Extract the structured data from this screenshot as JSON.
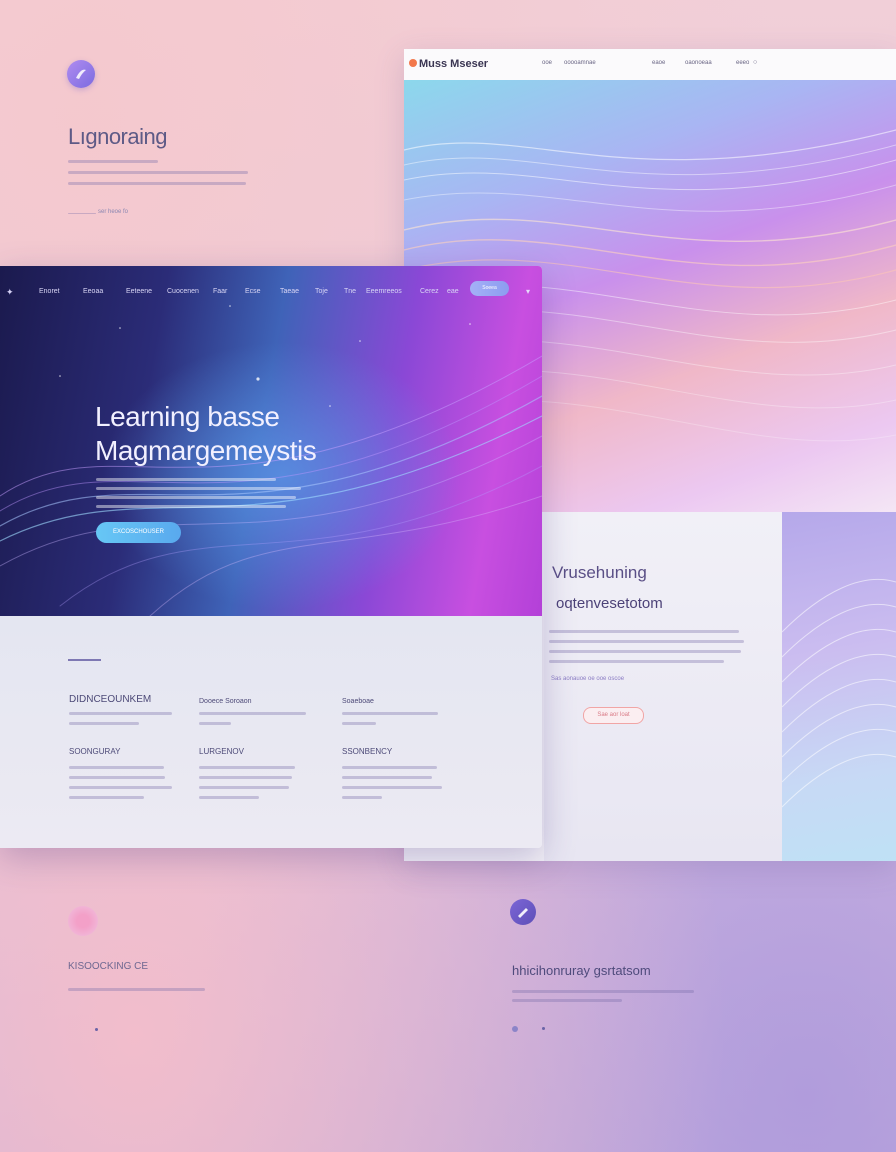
{
  "background": {
    "left_title": "Lıgnoraing",
    "left_link": "ser heoe fo",
    "bottom_left_title": "KISOOCKING CE",
    "bottom_right_title": "hhicihonruray gsrtatsom"
  },
  "back_window": {
    "brand": "Muss Mseser",
    "nav_items": [
      "ooe",
      "ooooamnae",
      "eaoe",
      "oaonoeaa",
      "eeeo"
    ],
    "section_title": "Vrusehuning",
    "section_subtitle": "oqtenvesetotom",
    "link": "Sas aonauoe oe ooe oscoe",
    "button": "Sae aor loat"
  },
  "front_window": {
    "nav_logo": "✦",
    "nav_items": [
      "Enoret",
      "Eeoaa",
      "Eeteene",
      "Cuocenen",
      "Faar",
      "Ecse",
      "Taeae",
      "Toje",
      "Tne",
      "Eeemreeos",
      "Cerez",
      "eae"
    ],
    "nav_button": "Soeea",
    "nav_caret": "▾",
    "hero_title_line1": "Learning basse",
    "hero_title_line2": "Magmargemeystis",
    "cta": "EXCOSCHOUSER",
    "features": [
      {
        "title": "DIDNCEOUNKEM"
      },
      {
        "title": "Dooece Soroaon"
      },
      {
        "title": "Soaeboae"
      },
      {
        "title": "SOONGURAY"
      },
      {
        "title": "LURGENOV"
      },
      {
        "title": "SSONBENCY"
      }
    ]
  },
  "colors": {
    "hero_start": "#1b1a4e",
    "hero_mid": "#3f63b8",
    "hero_end": "#c84fe0",
    "cta": "#62bdf2",
    "accent_button_border": "#f1a5a5"
  }
}
